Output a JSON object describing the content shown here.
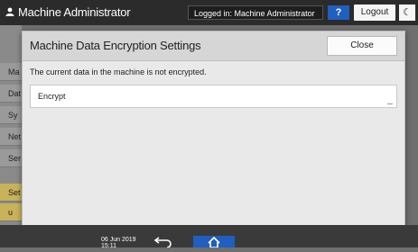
{
  "header": {
    "title": "Machine Administrator",
    "login_status": "Logged in: Machine Administrator",
    "help_label": "?",
    "logout_label": "Logout",
    "mode_icon": "moon-icon"
  },
  "background_side": {
    "items": [
      "Ma",
      "Dat",
      "Sy",
      "Net",
      "Ser",
      "Set",
      "u"
    ]
  },
  "dialog": {
    "title": "Machine Data Encryption Settings",
    "close_label": "Close",
    "status_text": "The current data in the machine is not encrypted.",
    "encrypt_label": "Encrypt"
  },
  "footer": {
    "date_line1": "06 Jun 2019",
    "date_line2": "15:11",
    "back_icon": "back-arrow-icon",
    "home_icon": "home-icon"
  },
  "colors": {
    "accent_blue": "#1f5fbf",
    "topbar": "#2b2b2b",
    "dialog_bg": "#e9e9e9"
  }
}
